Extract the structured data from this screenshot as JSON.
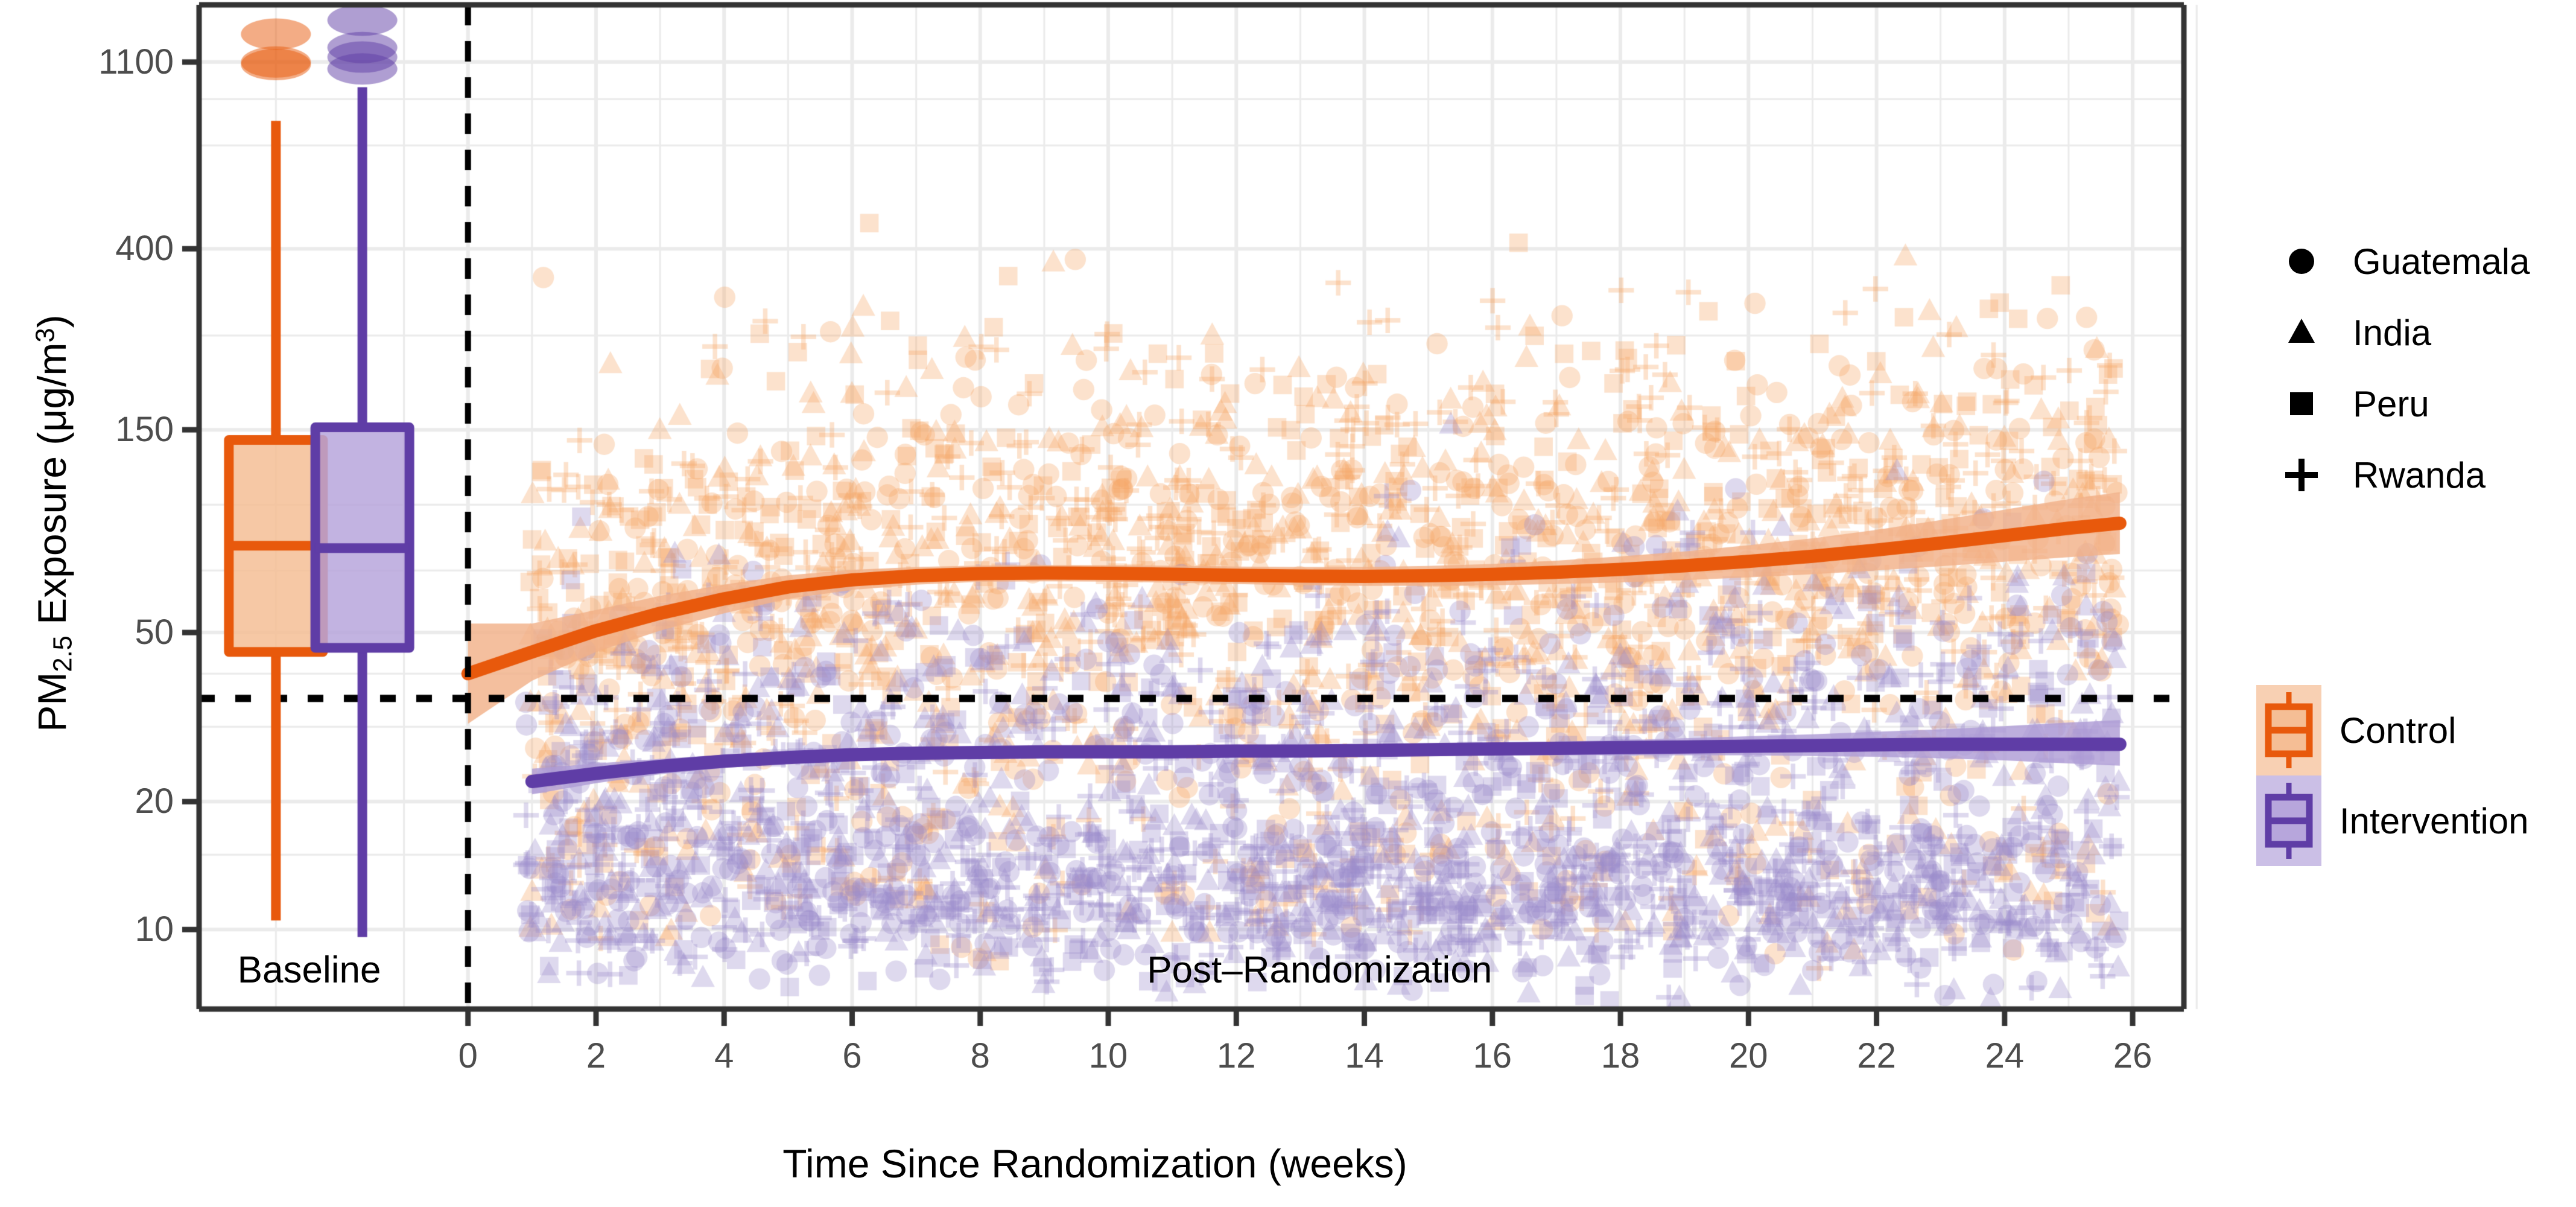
{
  "chart_data": {
    "type": "scatter",
    "title": "",
    "xlabel": "Time Since Randomization (weeks)",
    "ylabel": "PM2.5 Exposure (μg/m3)",
    "ylabel_parts": {
      "prefix": "PM",
      "sub": "2.5",
      "mid": " Exposure (μg/m",
      "sup": "3",
      "suffix": ")"
    },
    "yscale": "log",
    "ylim": [
      6.5,
      1500
    ],
    "yticks": [
      10,
      20,
      50,
      150,
      400,
      1100
    ],
    "ytick_labels": [
      "10",
      "20",
      "50",
      "150",
      "400",
      "1100"
    ],
    "y_minor_gridlines": [
      15,
      30,
      40,
      70,
      100,
      250,
      700,
      900
    ],
    "xlim": [
      -4.2,
      26.8
    ],
    "xticks": [
      0,
      2,
      4,
      6,
      8,
      10,
      12,
      14,
      16,
      18,
      20,
      22,
      24,
      26
    ],
    "xtick_labels": [
      "0",
      "2",
      "4",
      "6",
      "8",
      "10",
      "12",
      "14",
      "16",
      "18",
      "20",
      "22",
      "24",
      "26"
    ],
    "grid": true,
    "legend_position": "right",
    "annotations": [
      {
        "name": "baseline-label",
        "text": "Baseline",
        "x": -3.6,
        "y": 7.9,
        "align": "left"
      },
      {
        "name": "post-randomization-label",
        "text": "Post–Randomization",
        "x": 13.3,
        "y": 7.9,
        "align": "center"
      }
    ],
    "reference_lines": [
      {
        "name": "randomization-divider",
        "orientation": "vertical",
        "x": 0,
        "style": "dashed",
        "color": "#000000",
        "width": 10
      },
      {
        "name": "who-guideline-threshold",
        "orientation": "horizontal",
        "y": 35,
        "style": "dotted",
        "color": "#000000",
        "width": 12
      }
    ],
    "baseline_boxplots": [
      {
        "name": "control-baseline-box",
        "group": "Control",
        "x": -3.0,
        "color": "#E8590C",
        "fill": "#F5BE95",
        "min": 10.5,
        "q1": 45,
        "median": 80,
        "q3": 142,
        "max": 800,
        "outliers": [
          1100,
          1085,
          1280
        ]
      },
      {
        "name": "intervention-baseline-box",
        "group": "Intervention",
        "x": -1.65,
        "color": "#5F3DA6",
        "fill": "#B7A6DC",
        "min": 9.6,
        "q1": 46,
        "median": 79,
        "q3": 152,
        "max": 960,
        "outliers": [
          1060,
          1130,
          1190,
          1380
        ]
      }
    ],
    "series": [
      {
        "name": "Control",
        "color": "#E8590C",
        "ribbon_color": "#F2B189",
        "point_color": "#F7A668",
        "x": [
          0.0,
          1.0,
          2.0,
          3.0,
          4.0,
          5.0,
          6.0,
          7.0,
          8.0,
          9.0,
          10.0,
          11.0,
          12.0,
          13.0,
          14.0,
          15.0,
          16.0,
          17.0,
          18.0,
          19.0,
          20.0,
          21.0,
          22.0,
          23.0,
          24.0,
          25.0,
          25.8
        ],
        "fit": [
          40.0,
          45.0,
          50.5,
          55.5,
          60.0,
          64.0,
          66.5,
          68.0,
          68.8,
          69.0,
          68.9,
          68.6,
          68.2,
          67.9,
          67.8,
          68.0,
          68.5,
          69.3,
          70.4,
          71.8,
          73.5,
          75.6,
          78.2,
          81.2,
          84.5,
          88.0,
          90.4
        ],
        "ci_low": [
          30.5,
          38.5,
          45.0,
          50.5,
          55.5,
          60.0,
          63.0,
          64.8,
          65.8,
          66.0,
          65.9,
          65.5,
          65.0,
          64.6,
          64.4,
          64.4,
          64.6,
          65.0,
          65.6,
          66.4,
          67.4,
          68.6,
          70.0,
          71.6,
          73.4,
          75.2,
          76.5
        ],
        "ci_high": [
          52.5,
          52.5,
          56.5,
          61.0,
          64.8,
          68.2,
          70.2,
          71.3,
          71.9,
          72.1,
          72.0,
          71.8,
          71.5,
          71.3,
          71.3,
          71.7,
          72.5,
          73.8,
          75.5,
          77.6,
          80.2,
          83.3,
          87.2,
          92.0,
          97.3,
          103.0,
          107.0
        ]
      },
      {
        "name": "Intervention",
        "color": "#5F3DA6",
        "ribbon_color": "#AE9CD6",
        "point_color": "#9B8CCB",
        "x": [
          1.0,
          2.0,
          3.0,
          4.0,
          5.0,
          6.0,
          7.0,
          8.0,
          9.0,
          10.0,
          11.0,
          12.0,
          13.0,
          14.0,
          15.0,
          16.0,
          17.0,
          18.0,
          19.0,
          20.0,
          21.0,
          22.0,
          23.0,
          24.0,
          25.0,
          25.8
        ],
        "fit": [
          22.3,
          23.3,
          24.2,
          24.9,
          25.4,
          25.8,
          26.0,
          26.1,
          26.2,
          26.2,
          26.2,
          26.3,
          26.3,
          26.4,
          26.5,
          26.6,
          26.7,
          26.8,
          26.9,
          27.0,
          27.1,
          27.2,
          27.3,
          27.3,
          27.3,
          27.3
        ],
        "ci_low": [
          20.8,
          22.1,
          23.2,
          24.0,
          24.6,
          25.0,
          25.3,
          25.4,
          25.5,
          25.5,
          25.5,
          25.5,
          25.6,
          25.6,
          25.6,
          25.7,
          25.7,
          25.7,
          25.7,
          25.7,
          25.6,
          25.5,
          25.3,
          25.0,
          24.6,
          24.3
        ],
        "ci_high": [
          23.9,
          24.6,
          25.2,
          25.8,
          26.2,
          26.6,
          26.8,
          26.9,
          26.9,
          27.0,
          27.0,
          27.0,
          27.1,
          27.2,
          27.3,
          27.5,
          27.7,
          27.9,
          28.2,
          28.5,
          28.8,
          29.2,
          29.6,
          30.1,
          30.7,
          31.1
        ]
      }
    ],
    "scatter_info": {
      "note": "Dense semi-transparent points, one per household-week, shaped by country and colored by arm",
      "n_points_approx": 4200,
      "alpha": 0.35
    }
  },
  "legends": [
    {
      "name": "country-legend",
      "title": "",
      "items": [
        {
          "label": "Guatemala",
          "marker": "circle"
        },
        {
          "label": "India",
          "marker": "triangle"
        },
        {
          "label": "Peru",
          "marker": "square"
        },
        {
          "label": "Rwanda",
          "marker": "plus"
        }
      ]
    },
    {
      "name": "arm-legend",
      "title": "",
      "items": [
        {
          "label": "Control",
          "marker": "boxplot",
          "color": "#E8590C",
          "fill": "#F5BE95"
        },
        {
          "label": "Intervention",
          "marker": "boxplot",
          "color": "#5F3DA6",
          "fill": "#B7A6DC"
        }
      ]
    }
  ],
  "colors": {
    "control": "#E8590C",
    "control_fill": "#F5BE95",
    "intervention": "#5F3DA6",
    "intervention_fill": "#B7A6DC",
    "panel_background": "#FFFFFF",
    "gridline": "#EBEBEB",
    "axis": "#333333",
    "tick_text": "#4D4D4D"
  },
  "geometry": {
    "panel_left": 330,
    "panel_right": 3620,
    "panel_top": 8,
    "panel_bottom": 1672
  }
}
